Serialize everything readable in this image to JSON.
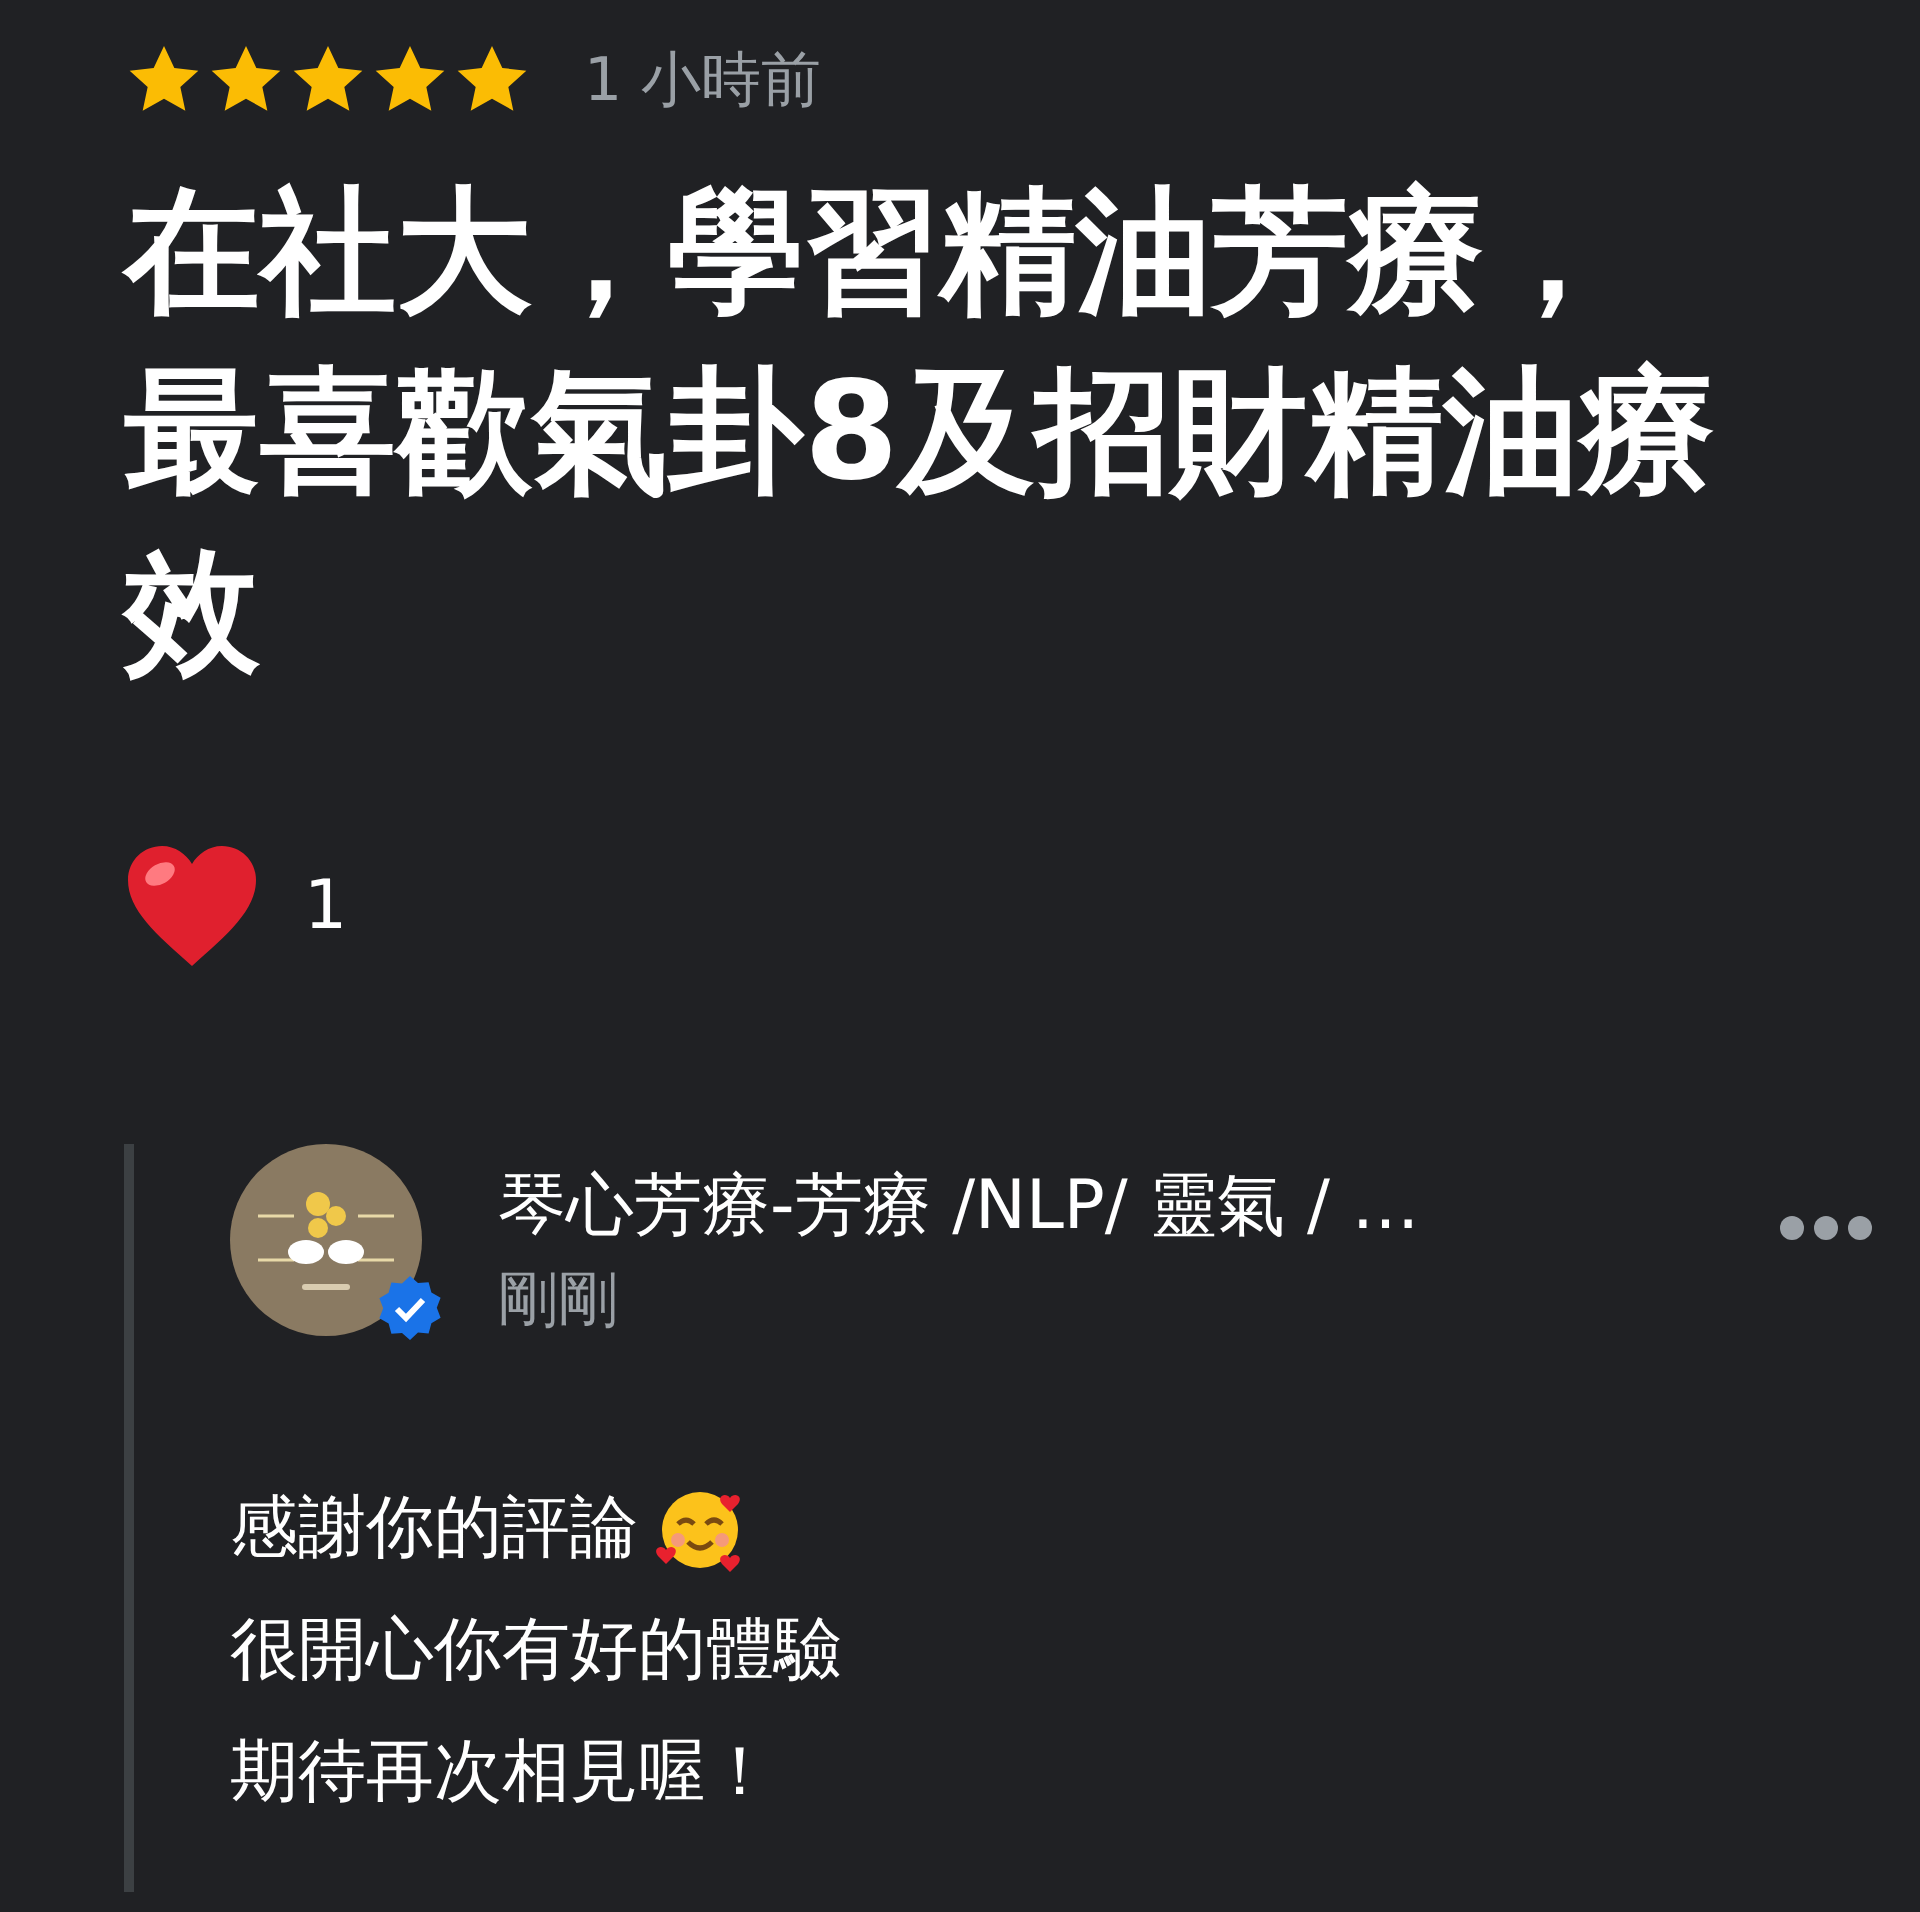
{
  "review": {
    "stars": 5,
    "time": "1 小時前",
    "text": "在社大，學習精油芳療，最喜歡氣卦8及招財精油療效",
    "reactions": [
      {
        "kind": "heart",
        "count": "1"
      }
    ]
  },
  "reply": {
    "avatar": {
      "kind": "picture",
      "verified": true
    },
    "author": "琴心芳療-芳療 /NLP/ 靈氣 / …",
    "time": "剛剛",
    "lines": [
      {
        "text": "感謝你的評論",
        "emoji": true
      },
      {
        "text": "很開心你有好的體驗"
      },
      {
        "text": "期待再次相見喔！"
      }
    ]
  }
}
